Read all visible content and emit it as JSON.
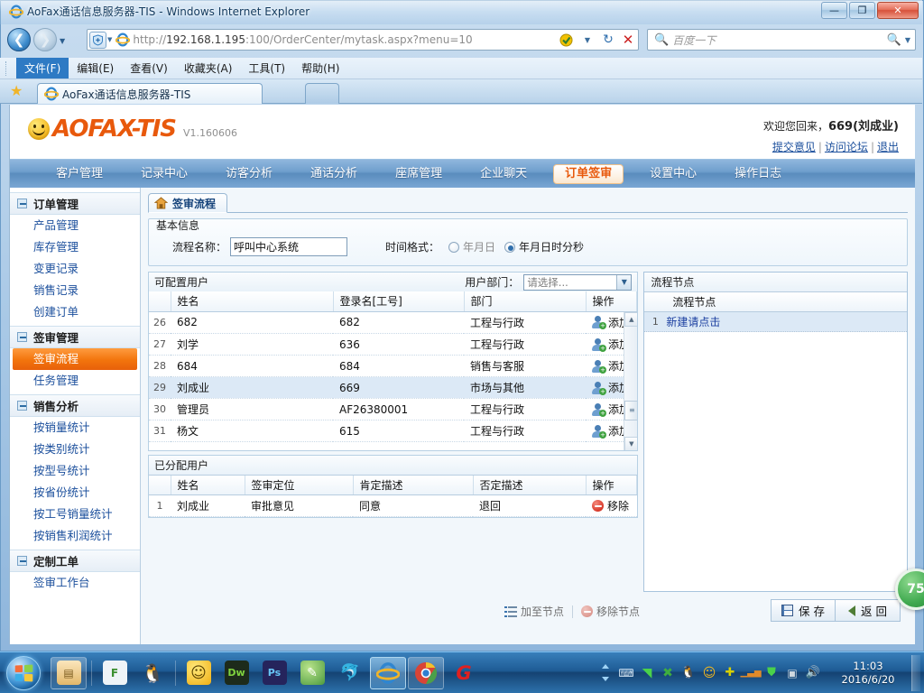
{
  "browser": {
    "title": "AoFax通话信息服务器-TIS - Windows Internet Explorer",
    "url_scheme": "http://",
    "url_host": "192.168.1.195",
    "url_rest": ":100/OrderCenter/mytask.aspx?menu=10",
    "search_placeholder": "百度一下",
    "window_buttons": {
      "minimize": "—",
      "maximize": "❐",
      "close": "✕"
    },
    "menus": [
      {
        "label": "文件(F)",
        "selected": true
      },
      {
        "label": "编辑(E)",
        "selected": false
      },
      {
        "label": "查看(V)",
        "selected": false
      },
      {
        "label": "收藏夹(A)",
        "selected": false
      },
      {
        "label": "工具(T)",
        "selected": false
      },
      {
        "label": "帮助(H)",
        "selected": false
      }
    ],
    "tab_label": "AoFax通话信息服务器-TIS"
  },
  "app": {
    "logo_text": "AOFAX-TIS",
    "version": "V1.160606",
    "welcome_prefix": "欢迎您回来，",
    "welcome_user": "669(刘成业)",
    "user_links": [
      "提交意见",
      "访问论坛",
      "退出"
    ],
    "accent_color": "#e8590c",
    "nav": [
      {
        "label": "客户管理",
        "active": false
      },
      {
        "label": "记录中心",
        "active": false
      },
      {
        "label": "访客分析",
        "active": false
      },
      {
        "label": "通话分析",
        "active": false
      },
      {
        "label": "座席管理",
        "active": false
      },
      {
        "label": "企业聊天",
        "active": false
      },
      {
        "label": "订单签审",
        "active": true
      },
      {
        "label": "设置中心",
        "active": false
      },
      {
        "label": "操作日志",
        "active": false
      }
    ]
  },
  "sidebar": {
    "groups": [
      {
        "label": "订单管理",
        "items": [
          {
            "label": "产品管理",
            "active": false
          },
          {
            "label": "库存管理",
            "active": false
          },
          {
            "label": "变更记录",
            "active": false
          },
          {
            "label": "销售记录",
            "active": false
          },
          {
            "label": "创建订单",
            "active": false
          }
        ]
      },
      {
        "label": "签审管理",
        "items": [
          {
            "label": "签审流程",
            "active": true
          },
          {
            "label": "任务管理",
            "active": false
          }
        ]
      },
      {
        "label": "销售分析",
        "items": [
          {
            "label": "按销量统计",
            "active": false
          },
          {
            "label": "按类别统计",
            "active": false
          },
          {
            "label": "按型号统计",
            "active": false
          },
          {
            "label": "按省份统计",
            "active": false
          },
          {
            "label": "按工号销量统计",
            "active": false
          },
          {
            "label": "按销售利润统计",
            "active": false
          }
        ]
      },
      {
        "label": "定制工单",
        "items": [
          {
            "label": "签审工作台",
            "active": false
          }
        ]
      }
    ]
  },
  "page": {
    "tab_label": "签审流程",
    "basic_info": {
      "legend": "基本信息",
      "flow_name_label": "流程名称：",
      "flow_name_value": "呼叫中心系统",
      "time_format_label": "时间格式：",
      "options": [
        {
          "label": "年月日",
          "selected": false
        },
        {
          "label": "年月日时分秒",
          "selected": true
        }
      ]
    },
    "available_users": {
      "title": "可配置用户",
      "dept_label": "用户部门：",
      "dept_value": "请选择...",
      "columns": [
        "",
        "姓名",
        "登录名[工号]",
        "部门",
        "操作"
      ],
      "rows": [
        {
          "num": "26",
          "name": "682",
          "login": "682",
          "dept": "工程与行政",
          "action": "添加",
          "highlight": false
        },
        {
          "num": "27",
          "name": "刘学",
          "login": "636",
          "dept": "工程与行政",
          "action": "添加",
          "highlight": false
        },
        {
          "num": "28",
          "name": "684",
          "login": "684",
          "dept": "销售与客服",
          "action": "添加",
          "highlight": false
        },
        {
          "num": "29",
          "name": "刘成业",
          "login": "669",
          "dept": "市场与其他",
          "action": "添加",
          "highlight": true
        },
        {
          "num": "30",
          "name": "管理员",
          "login": "AF26380001",
          "dept": "工程与行政",
          "action": "添加",
          "highlight": false
        },
        {
          "num": "31",
          "name": "杨文",
          "login": "615",
          "dept": "工程与行政",
          "action": "添加",
          "highlight": false
        }
      ]
    },
    "assigned_users": {
      "title": "已分配用户",
      "columns": [
        "",
        "姓名",
        "签审定位",
        "肯定描述",
        "否定描述",
        "操作"
      ],
      "rows": [
        {
          "num": "1",
          "name": "刘成业",
          "position": "审批意见",
          "positive": "同意",
          "negative": "退回",
          "action": "移除"
        }
      ]
    },
    "flow_nodes": {
      "title": "流程节点",
      "column": "流程节点",
      "rows": [
        {
          "num": "1",
          "label": "新建请点击"
        }
      ]
    },
    "footer": {
      "add_node": "加至节点",
      "remove_node": "移除节点",
      "save": "保 存",
      "back": "返 回"
    },
    "badge": "75"
  },
  "taskbar": {
    "clock_time": "11:03",
    "clock_date": "2016/6/20",
    "quicklaunch": [
      {
        "name": "file-explorer-icon",
        "glyph": "▤",
        "color": "#f0c060"
      },
      {
        "name": "foxmail-icon",
        "glyph": "F",
        "color": "#5a9e3f"
      },
      {
        "name": "qq-icon",
        "glyph": "🐧",
        "color": "#222222"
      },
      {
        "name": "aofax-smiley-icon",
        "glyph": "☺",
        "color": "#f5b81e"
      },
      {
        "name": "dreamweaver-icon",
        "glyph": "Dw",
        "color": "#1f2d1f"
      },
      {
        "name": "photoshop-icon",
        "glyph": "Ps",
        "color": "#27275b"
      },
      {
        "name": "youdao-note-icon",
        "glyph": "✎",
        "color": "#4c9a3f"
      },
      {
        "name": "navicat-icon",
        "glyph": "🐬",
        "color": "#9b6bd6"
      },
      {
        "name": "internet-explorer-icon",
        "glyph": "e",
        "color": "#1e78c8"
      },
      {
        "name": "chrome-icon",
        "glyph": "◉",
        "color": "#d94436"
      },
      {
        "name": "gg-icon",
        "glyph": "G",
        "color": "#e02020"
      }
    ],
    "tray": [
      {
        "name": "keyboard-icon",
        "glyph": "⌨",
        "color": "#dbe8f4"
      },
      {
        "name": "wifi-icon",
        "glyph": "◥",
        "color": "#4ad14a"
      },
      {
        "name": "xunlei-icon",
        "glyph": "✖",
        "color": "#3fae3f"
      },
      {
        "name": "qq-tray-icon",
        "glyph": "🐧",
        "color": "#e8a030"
      },
      {
        "name": "smiley-tray-icon",
        "glyph": "☺",
        "color": "#f5b81e"
      },
      {
        "name": "plus-tray-icon",
        "glyph": "✚",
        "color": "#d8d000"
      },
      {
        "name": "network-meter-icon",
        "glyph": "▁▃▅",
        "color": "#e08a2a"
      },
      {
        "name": "security-shield-icon",
        "glyph": "⛨",
        "color": "#4ad14a"
      },
      {
        "name": "network-error-icon",
        "glyph": "▣",
        "color": "#c8c8c8"
      },
      {
        "name": "volume-icon",
        "glyph": "🔊",
        "color": "#eaf3fb"
      }
    ]
  }
}
